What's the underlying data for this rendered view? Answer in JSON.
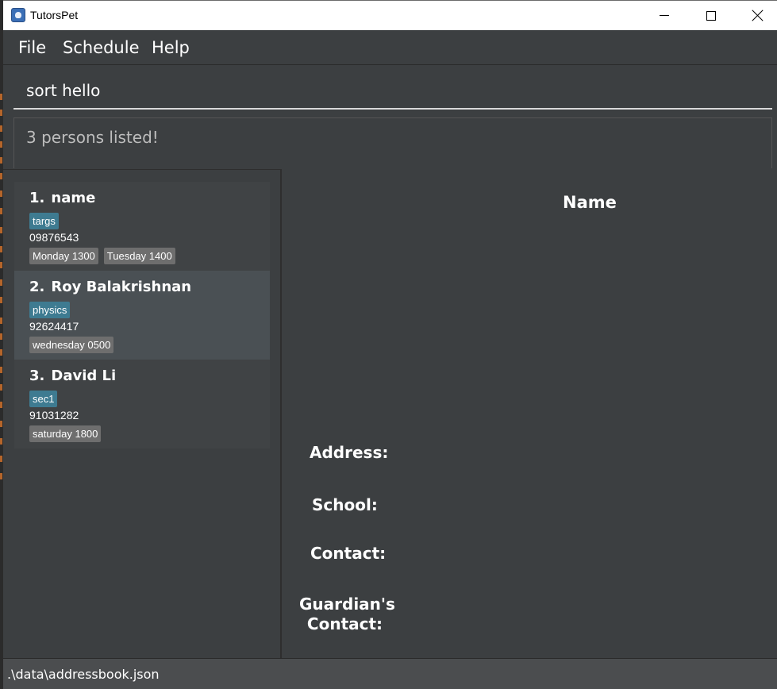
{
  "window": {
    "title": "TutorsPet"
  },
  "menu": {
    "file": "File",
    "schedule": "Schedule",
    "help": "Help"
  },
  "command": {
    "value": "sort hello"
  },
  "result": {
    "message": "3 persons listed!"
  },
  "persons": [
    {
      "index": "1.",
      "name": "name",
      "tags": [
        "targs"
      ],
      "phone": "09876543",
      "lessons": [
        "Monday 1300",
        "Tuesday 1400"
      ]
    },
    {
      "index": "2.",
      "name": "Roy Balakrishnan",
      "tags": [
        "physics"
      ],
      "phone": "92624417",
      "lessons": [
        "wednesday 0500"
      ]
    },
    {
      "index": "3.",
      "name": "David Li",
      "tags": [
        "sec1"
      ],
      "phone": "91031282",
      "lessons": [
        "saturday 1800"
      ]
    }
  ],
  "details": {
    "name": "Name",
    "address_label": "Address:",
    "school_label": "School:",
    "contact_label": "Contact:",
    "guardian_label_line1": "Guardian's",
    "guardian_label_line2": "Contact:"
  },
  "status": {
    "filepath": ".\\data\\addressbook.json"
  },
  "colors": {
    "background": "#3c3f41",
    "tag": "#3e7b91",
    "lesson": "#6e6e6e",
    "selected_card": "#4a5054"
  }
}
